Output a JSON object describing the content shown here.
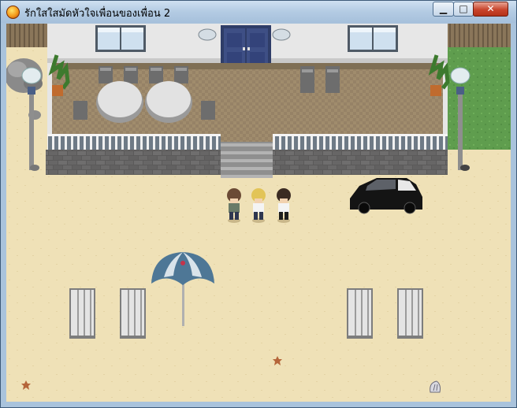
{
  "window": {
    "title": "รักใสใสมัดหัวใจเพื่อนของเพื่อน 2",
    "icon": "app-orb-icon",
    "controls": [
      {
        "name": "minimize-button",
        "glyph": "▁"
      },
      {
        "name": "maximize-button",
        "glyph": "□"
      },
      {
        "name": "close-button",
        "glyph": "✕"
      }
    ]
  },
  "scene": {
    "type": "rpg-map",
    "location": "beach-villa-front",
    "colors": {
      "sand": "#efe1b7",
      "wall": "#e6e6e6",
      "deck": "#9c8a6c",
      "stone": "#5d5c5c",
      "door": "#3a4a78",
      "grass": "#5f9d4e",
      "umbrella": "#4e7796"
    },
    "characters": [
      {
        "name": "brown-haired-boy",
        "hair": "#6b4a35",
        "shirt": "#6a7a68"
      },
      {
        "name": "blonde-boy",
        "hair": "#e2c457",
        "shirt": "#f4f4f4"
      },
      {
        "name": "dark-haired-boy",
        "hair": "#3b2b22",
        "shirt": "#f4f4f4"
      }
    ],
    "objects": [
      "black-car",
      "beach-umbrella",
      "sun-lounger",
      "sun-lounger",
      "sun-lounger",
      "sun-lounger",
      "starfish",
      "starfish",
      "seashell",
      "street-lamp",
      "street-lamp",
      "round-table",
      "round-table",
      "potted-plant",
      "potted-plant"
    ]
  }
}
